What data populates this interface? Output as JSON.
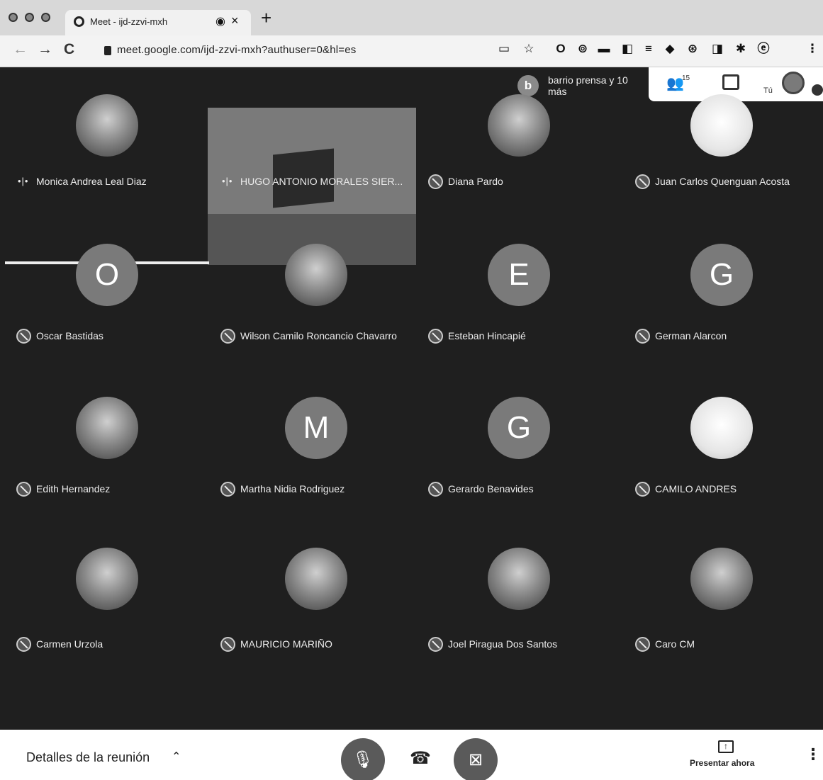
{
  "browser": {
    "tab_title": "Meet - ijd-zzvi-mxh",
    "new_tab": "+",
    "close": "×",
    "audio": "◉",
    "back": "←",
    "forward": "→",
    "reload": "C",
    "url": "meet.google.com/ijd-zzvi-mxh?authuser=0&hl=es",
    "extensions": [
      "▭",
      "☆",
      "O",
      "⊚",
      "▬",
      "◧",
      "≡",
      "◆",
      "⊛",
      "◨",
      "✱",
      "ⓔ",
      "⋮"
    ]
  },
  "meeting": {
    "presenter": {
      "initial": "b",
      "name": "barrio prensa y 10 más"
    },
    "people_count": "15",
    "self_label": "Tú",
    "participants": [
      {
        "name": "Monica Andrea Leal Diaz",
        "initial": "",
        "style": "photo",
        "status": "speaking"
      },
      {
        "name": "HUGO ANTONIO MORALES SIER...",
        "initial": "",
        "style": "video",
        "status": "speaking"
      },
      {
        "name": "Diana Pardo",
        "initial": "",
        "style": "photo",
        "status": "muted"
      },
      {
        "name": "Juan Carlos Quenguan Acosta",
        "initial": "",
        "style": "light",
        "status": "muted"
      },
      {
        "name": "Oscar Bastidas",
        "initial": "O",
        "style": "letter",
        "status": "muted"
      },
      {
        "name": "Wilson Camilo Roncancio Chavarro",
        "initial": "",
        "style": "photo",
        "status": "muted"
      },
      {
        "name": "Esteban Hincapié",
        "initial": "E",
        "style": "letter",
        "status": "muted"
      },
      {
        "name": "German Alarcon",
        "initial": "G",
        "style": "letter",
        "status": "muted"
      },
      {
        "name": "Edith Hernandez",
        "initial": "",
        "style": "photo",
        "status": "muted"
      },
      {
        "name": "Martha Nidia Rodriguez",
        "initial": "M",
        "style": "letter",
        "status": "muted"
      },
      {
        "name": "Gerardo Benavides",
        "initial": "G",
        "style": "letter",
        "status": "muted"
      },
      {
        "name": "CAMILO ANDRES",
        "initial": "",
        "style": "light",
        "status": "muted"
      },
      {
        "name": "Carmen Urzola",
        "initial": "",
        "style": "photo",
        "status": "muted"
      },
      {
        "name": "MAURICIO MARIÑO",
        "initial": "",
        "style": "photo",
        "status": "muted"
      },
      {
        "name": "Joel Piragua Dos Santos",
        "initial": "",
        "style": "photo",
        "status": "muted"
      },
      {
        "name": "Caro CM",
        "initial": "",
        "style": "photo",
        "status": "muted"
      }
    ]
  },
  "bottom_bar": {
    "details_label": "Detalles de la reunión",
    "present_label": "Presentar ahora"
  },
  "icons": {
    "mic_off": "mic-off-icon",
    "hangup": "hangup-icon",
    "cam_off": "camera-off-icon",
    "present": "present-screen-icon",
    "more": "more-vert-icon"
  }
}
